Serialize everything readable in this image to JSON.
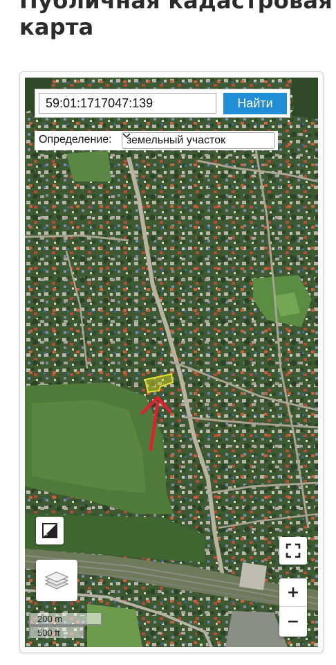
{
  "page": {
    "title_line1": "Публичная кадастровая",
    "title_line2": "карта"
  },
  "search": {
    "value": "59:01:1717047:139",
    "button_label": "Найти"
  },
  "definition": {
    "label": "Определение:",
    "selected": "земельный участок"
  },
  "controls": {
    "ruler_icon": "ruler-icon",
    "layers_icon": "layers-icon",
    "fullscreen_icon": "fullscreen-icon",
    "zoom_in_label": "+",
    "zoom_out_label": "−"
  },
  "scale": {
    "metric": "200 m",
    "imperial": "500 ft"
  },
  "colors": {
    "accent_button": "#1f8ed6",
    "parcel_highlight": "#e6e02a",
    "annotation_arrow": "#e0202e"
  }
}
